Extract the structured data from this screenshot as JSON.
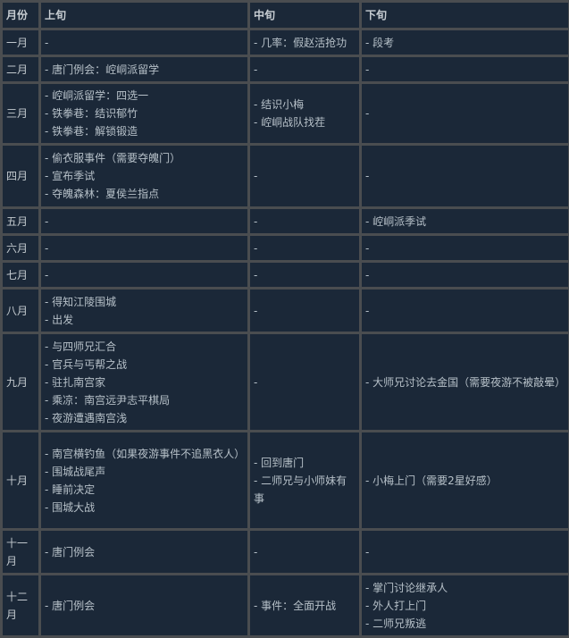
{
  "headers": [
    "月份",
    "上旬",
    "中旬",
    "下旬"
  ],
  "rows": [
    {
      "month": "一月",
      "early": [
        "-"
      ],
      "mid": [
        "- 几率：假赵活抢功"
      ],
      "late": [
        "- 段考"
      ]
    },
    {
      "month": "二月",
      "early": [
        "- 唐门例会：崆峒派留学"
      ],
      "mid": [
        "-"
      ],
      "late": [
        "-"
      ]
    },
    {
      "month": "三月",
      "early": [
        "- 崆峒派留学：四选一",
        "- 铁拳巷：结识郁竹",
        "- 铁拳巷：解锁锻造"
      ],
      "mid": [
        "- 结识小梅",
        "- 崆峒战队找茬"
      ],
      "late": [
        "-"
      ]
    },
    {
      "month": "四月",
      "early": [
        "- 偷衣服事件（需要夺魄门）",
        "- 宣布季试",
        "- 夺魄森林：夏侯兰指点"
      ],
      "mid": [
        "-"
      ],
      "late": [
        "-"
      ]
    },
    {
      "month": "五月",
      "early": [
        "-"
      ],
      "mid": [
        "-"
      ],
      "late": [
        "- 崆峒派季试"
      ]
    },
    {
      "month": "六月",
      "early": [
        "-"
      ],
      "mid": [
        "-"
      ],
      "late": [
        "-"
      ]
    },
    {
      "month": "七月",
      "early": [
        "-"
      ],
      "mid": [
        "-"
      ],
      "late": [
        "-"
      ]
    },
    {
      "month": "八月",
      "early": [
        "- 得知江陵围城",
        "- 出发"
      ],
      "mid": [
        "-"
      ],
      "late": [
        "-"
      ]
    },
    {
      "month": "九月",
      "early": [
        "- 与四师兄汇合",
        "- 官兵与丐帮之战",
        "- 驻扎南宫家",
        "- 乘凉：南宫远尹志平棋局",
        "- 夜游遭遇南宫浅"
      ],
      "mid": [
        "-"
      ],
      "late": [
        "- 大师兄讨论去金国（需要夜游不被敲晕）"
      ]
    },
    {
      "month": "十月",
      "early": [
        "- 南宫横钓鱼（如果夜游事件不追黑衣人）",
        "- 围城战尾声",
        "- 睡前决定",
        "- 围城大战"
      ],
      "mid": [
        "- 回到唐门",
        "- 二师兄与小师妹有事"
      ],
      "late": [
        "- 小梅上门（需要2星好感）"
      ]
    },
    {
      "month": "十一月",
      "early": [
        "- 唐门例会"
      ],
      "mid": [
        "-"
      ],
      "late": [
        "-"
      ]
    },
    {
      "month": "十二月",
      "early": [
        "- 唐门例会"
      ],
      "mid": [
        "- 事件：全面开战"
      ],
      "late": [
        "- 掌门讨论继承人",
        "- 外人打上门",
        "- 二师兄叛逃"
      ]
    }
  ]
}
